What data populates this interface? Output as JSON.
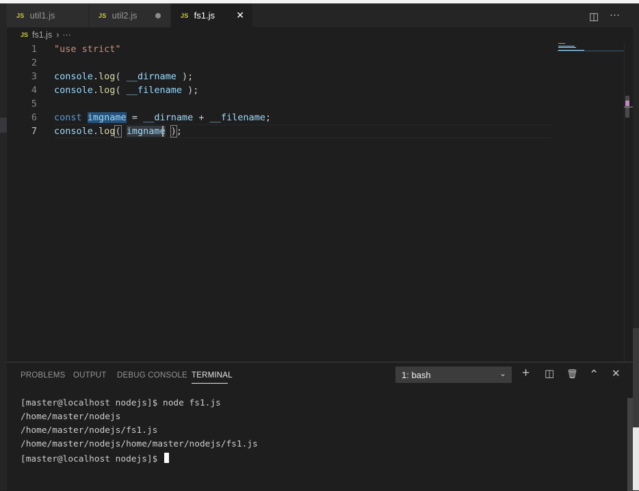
{
  "tabs": [
    {
      "label": "util1.js",
      "badge": "JS",
      "state": "inactive"
    },
    {
      "label": "util2.js",
      "badge": "JS",
      "state": "modified"
    },
    {
      "label": "fs1.js",
      "badge": "JS",
      "state": "active"
    }
  ],
  "tab_actions": {
    "split_icon": "split-editor-icon",
    "more_icon": "more-actions-icon",
    "split_glyph": "◫",
    "more_glyph": "···",
    "close_glyph": "✕"
  },
  "breadcrumb": {
    "badge": "JS",
    "file": "fs1.js",
    "separator": "›",
    "more": "···"
  },
  "editor": {
    "line_numbers": [
      "1",
      "2",
      "3",
      "4",
      "5",
      "6",
      "7"
    ],
    "current_line": "7",
    "lines": {
      "l1": {
        "str": "\"use strict\""
      },
      "l3": {
        "obj": "console",
        "dot": ".",
        "fn": "log",
        "open": "( ",
        "arg": "__dirname",
        "close": " );"
      },
      "l4": {
        "obj": "console",
        "dot": ".",
        "fn": "log",
        "open": "( ",
        "arg": "__filename",
        "close": " );"
      },
      "l6": {
        "kw": "const",
        "name": "imgname",
        "eq": " = ",
        "a": "__dirname",
        "plus": " + ",
        "b": "__filename",
        "semi": ";"
      },
      "l7": {
        "obj": "console",
        "dot": ".",
        "fn": "log",
        "open": "(",
        "sp": " ",
        "arg": "imgname",
        "sp2": " ",
        "close": ")",
        "semi": ";"
      }
    }
  },
  "panel": {
    "tabs": [
      "PROBLEMS",
      "OUTPUT",
      "DEBUG CONSOLE",
      "TERMINAL"
    ],
    "active_tab": "TERMINAL",
    "terminal_select": "1: bash",
    "icons": {
      "add": "+",
      "split": "◫",
      "trash": "🗑",
      "maximize": "⌃",
      "close": "✕"
    },
    "terminal_lines": [
      "[master@localhost nodejs]$ node fs1.js",
      "/home/master/nodejs",
      "/home/master/nodejs/fs1.js",
      "/home/master/nodejs/home/master/nodejs/fs1.js"
    ],
    "prompt": "[master@localhost nodejs]$ "
  },
  "colors": {
    "keyword": "#569cd6",
    "variable": "#9cdcfe",
    "function": "#dcdcaa",
    "string": "#ce9178",
    "js_badge": "#cbcb41"
  }
}
